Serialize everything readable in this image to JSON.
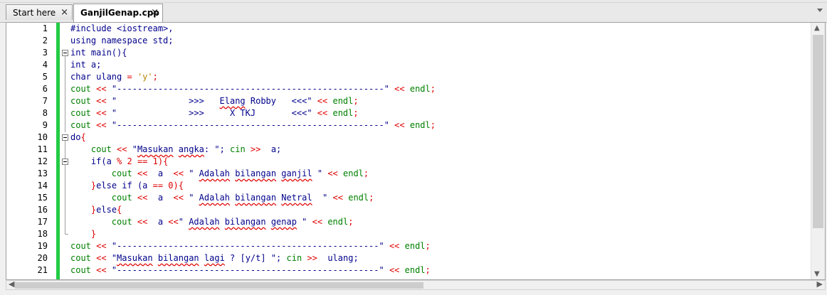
{
  "tabs": [
    {
      "label": "Start here",
      "active": false
    },
    {
      "label": "GanjilGenap.cpp",
      "active": true
    }
  ],
  "tab_close_glyph": "×",
  "line_numbers": [
    "1",
    "2",
    "3",
    "4",
    "5",
    "6",
    "7",
    "8",
    "9",
    "10",
    "11",
    "12",
    "13",
    "14",
    "15",
    "16",
    "17",
    "18",
    "19",
    "20",
    "21"
  ],
  "code": {
    "l1": "#include <iostream>,",
    "l2_kw": "using namespace",
    "l2_rest": " std;",
    "l3_kw": "int",
    "l3_rest": " main(){",
    "l4_kw": "int",
    "l4_rest": " a;",
    "l5_kw": "char",
    "l5_mid": " ulang ",
    "l5_eq": "=",
    "l5_chr": " 'y'",
    "l5_end": ";",
    "cout": "cout",
    "endl": "endl",
    "ins": " << ",
    "ext": " >> ",
    "l6_str": "\"----------------------------------------------------\"",
    "l7_str_a": "\"              >>>   ",
    "l7_str_sq": "Elang",
    "l7_str_b": " Robby   <<<\"",
    "l8_str": "\"              >>>     X TKJ       <<<\"",
    "l9_str": "\"----------------------------------------------------\"",
    "l10_kw": "do",
    "l10_rest": "{",
    "l11_a": "\"",
    "l11_sq1": "Masukan",
    "l11_sp": " ",
    "l11_sq2": "angka",
    "l11_b": ": \";",
    "l11_cin": " cin",
    "l11_end": " a;",
    "l12_kw": "if",
    "l12_a": "(a ",
    "l12_op": "% 2 == 1",
    "l12_b": "){",
    "l13_a": " a ",
    "l13_str_a": "\" ",
    "l13_sq1": "Adalah",
    "l13_sq2": "bilangan",
    "l13_sq3": "ganjil",
    "l13_str_b": " \"",
    "l14_a": "}",
    "l14_kw": "else if",
    "l14_b": " (a ",
    "l14_op": "== 0",
    "l14_c": "){",
    "l15_sq3": "Netral",
    "l15_str_b": "  \"",
    "l16_a": "}",
    "l16_kw": "else",
    "l16_b": "{",
    "l17_str_a": "\" ",
    "l17_sq3": "genap",
    "l17_str_b": " \"",
    "l18": "}",
    "l19_str": "\"---------------------------------------------------\"",
    "l20_sq1": "Masukan",
    "l20_sq2": "bilangan",
    "l20_sq3": "lagi",
    "l20_b": " ? [y/t] \";",
    "l20_cin": " cin",
    "l20_end": " ulang;",
    "l21_str": "\"---------------------------------------------------\"",
    "semi": ";"
  },
  "colors": {
    "change_bar": "#22cc44",
    "keyword": "#00008b",
    "stream": "#008000",
    "operator": "#e00000",
    "char_literal": "#b8860b"
  },
  "icons": [
    "close-icon",
    "fold-collapse-icon",
    "scroll-up-icon",
    "scroll-down-icon",
    "scroll-left-icon",
    "scroll-right-icon",
    "tab-list-dropdown-icon"
  ]
}
